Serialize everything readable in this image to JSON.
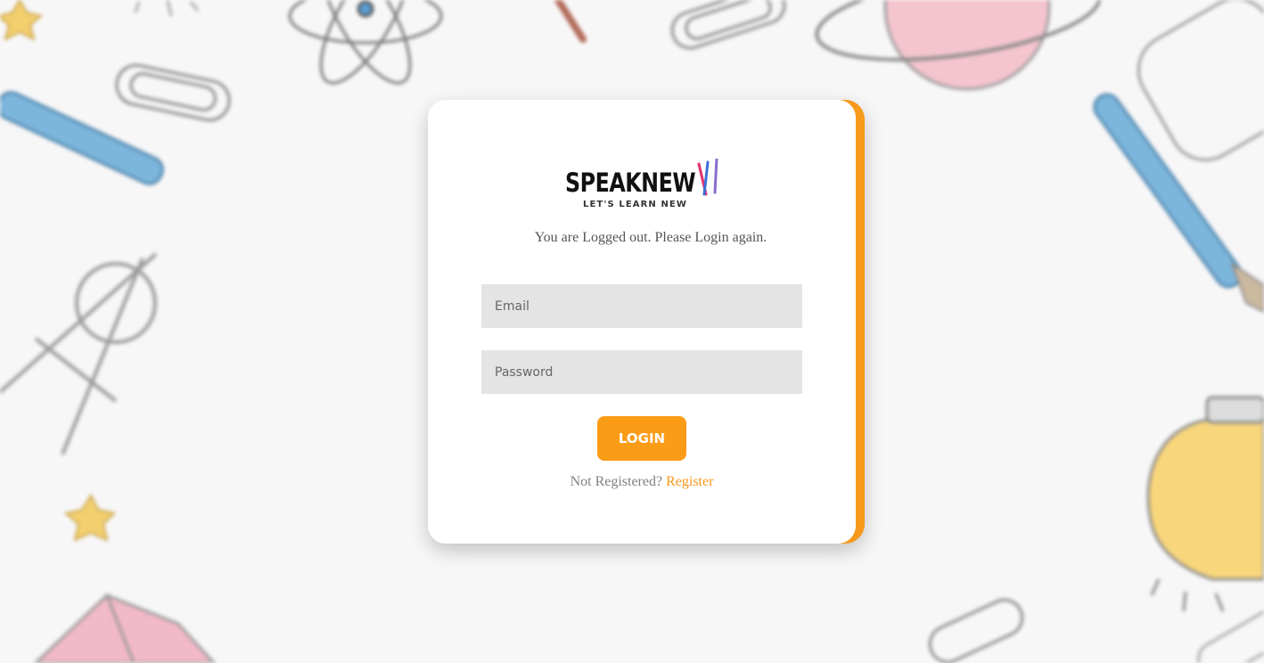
{
  "brand": {
    "name": "SPEAKNEW",
    "tagline": "LET'S LEARN NEW"
  },
  "login": {
    "message": "You are Logged out. Please Login again.",
    "email_placeholder": "Email",
    "password_placeholder": "Password",
    "button_label": "LOGIN",
    "register_prompt": "Not Registered?",
    "register_link": "Register"
  },
  "icons": {
    "background": [
      "star-icon",
      "atom-icon",
      "paperclip-icon",
      "pen-icon",
      "compass-icon",
      "planet-icon",
      "paintbrush-icon",
      "lightbulb-icon",
      "book-icon",
      "pencil-icon"
    ],
    "logo": "pens-icon"
  },
  "colors": {
    "accent": "#f7991a",
    "button": "#fb9c17",
    "field_bg": "#e4e4e4",
    "page_bg": "#f8f7f8"
  }
}
